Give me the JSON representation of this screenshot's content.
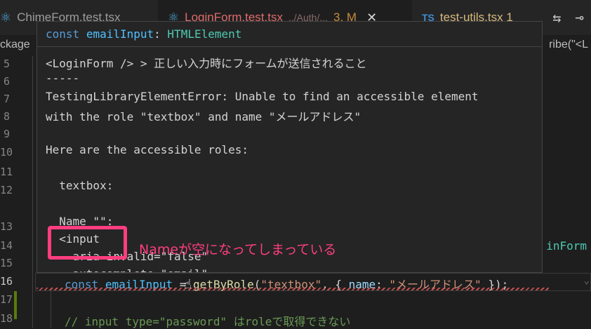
{
  "tabs": [
    {
      "label": "ChimeForm.test.tsx",
      "icon": "react-icon"
    },
    {
      "label": "LoginForm.test.tsx",
      "path": "../Auth/...",
      "badge": "3, M",
      "icon": "react-icon",
      "active": true,
      "close": "✕"
    },
    {
      "label": "test-utils.tsx 1",
      "icon_text": "TS",
      "icon": "ts-icon"
    }
  ],
  "tab_actions": {
    "compare_icon": "git-compare-icon",
    "timeline_icon": "timeline-icon",
    "compare_glyph": "⇆",
    "timeline_glyph": "⊸"
  },
  "breadcrumb": {
    "left": "ckage",
    "right": "ribe(\"<L"
  },
  "line_numbers": [
    "5",
    "6",
    "7",
    "8",
    "9",
    "10",
    "11",
    "12",
    "13",
    "14",
    "15",
    "16",
    "17",
    "18"
  ],
  "hover": {
    "signature": {
      "kw": "const",
      "name": "emailInput",
      "sep": ":",
      "type": "HTMLElement"
    },
    "lines": [
      "<LoginForm /> > 正しい入力時にフォームが送信されること",
      "-----",
      "TestingLibraryElementError: Unable to find an accessible element",
      "with the role \"textbox\" and name \"メールアドレス\"",
      "Here are the accessible roles:",
      "  textbox:",
      "  Name \"\":",
      "  <input",
      "    aria-invalid=\"false\"",
      "    autocomplete=\"email\""
    ]
  },
  "annotation": "Nameが空になってしまっている",
  "code": {
    "line16": {
      "kw": "const",
      "var": "emailInput",
      "eq": " = ",
      "fn": "getByRole",
      "open": "(",
      "str1": "\"textbox\"",
      "mid": ", { ",
      "prop": "name",
      "colon": ": ",
      "str2": "\"メールアドレス\"",
      "close": " });"
    },
    "line18_comment": "// input type=\"password\" はroleで取得できない"
  },
  "right_fragment": "inForm",
  "right_chevron": "⌄",
  "colors": {
    "accent_pink": "#ff3d7f",
    "error_red": "#e06c6c",
    "keyword": "#569cd6"
  }
}
